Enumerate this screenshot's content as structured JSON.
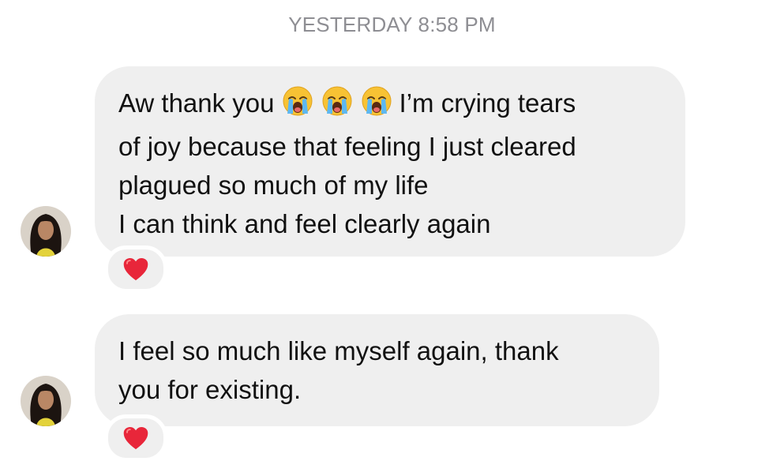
{
  "thread": {
    "timestamp": "YESTERDAY 8:58 PM"
  },
  "messages": [
    {
      "lines": [
        {
          "before": "Aw thank you",
          "after": "I’m crying tears"
        },
        "of joy because that feeling I just cleared",
        "plagued so much of my life",
        "I can think and feel clearly again"
      ],
      "inline_emoji": [
        "loudly-crying-face",
        "loudly-crying-face",
        "loudly-crying-face"
      ],
      "reaction": "red-heart"
    },
    {
      "lines": [
        "I feel so much like myself again, thank",
        "you for existing."
      ],
      "reaction": "red-heart"
    }
  ],
  "colors": {
    "bubble": "#efefef",
    "text": "#111111",
    "timestamp": "#8e8e93",
    "heart": "#e8263a"
  }
}
